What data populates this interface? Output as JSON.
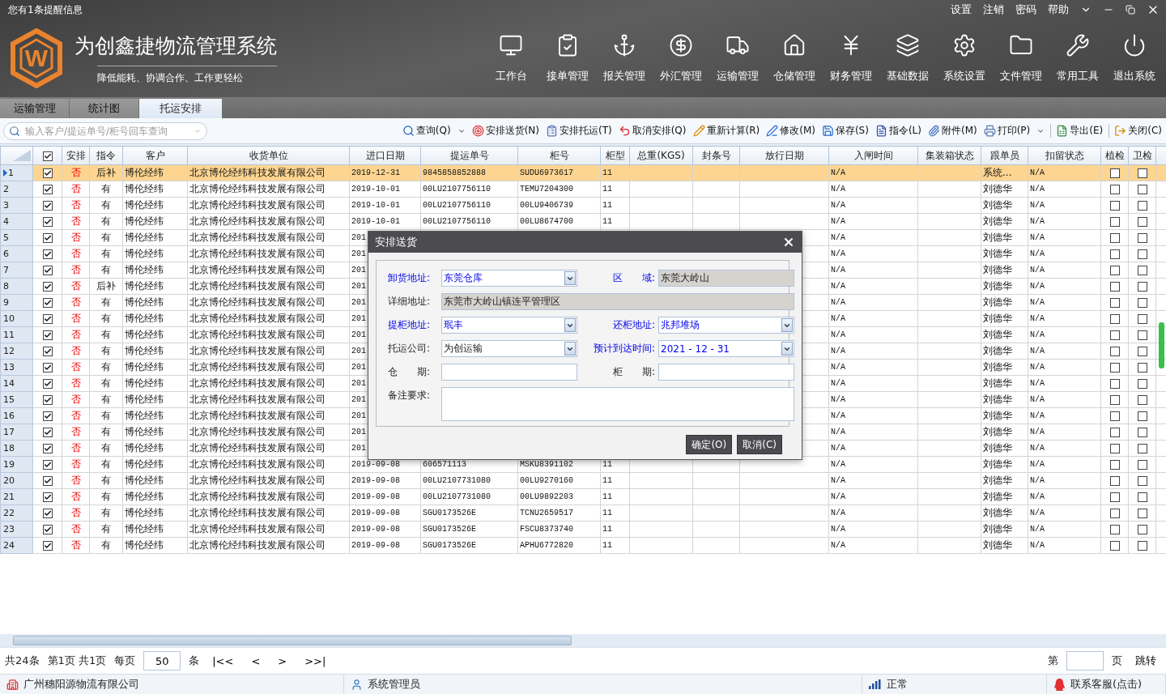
{
  "notice": "您有1条提醒信息",
  "top_links": [
    "设置",
    "注销",
    "密码",
    "帮助"
  ],
  "logo": {
    "letter": "W",
    "title": "为创鑫捷物流管理系统",
    "slogan": "降低能耗、协调合作、工作更轻松"
  },
  "nav": [
    {
      "label": "工作台"
    },
    {
      "label": "接单管理"
    },
    {
      "label": "报关管理"
    },
    {
      "label": "外汇管理"
    },
    {
      "label": "运输管理"
    },
    {
      "label": "仓储管理"
    },
    {
      "label": "财务管理"
    },
    {
      "label": "基础数据"
    },
    {
      "label": "系统设置"
    },
    {
      "label": "文件管理"
    },
    {
      "label": "常用工具"
    },
    {
      "label": "退出系统"
    }
  ],
  "tabs": [
    {
      "label": "运输管理",
      "selected": false
    },
    {
      "label": "统计图",
      "selected": false
    },
    {
      "label": "托运安排",
      "selected": true
    }
  ],
  "search": {
    "placeholder": "输入客户/提运单号/柜号回车查询"
  },
  "toolbar": [
    {
      "label": "查询(Q)",
      "dropdown": true,
      "separator_before": false
    },
    {
      "label": "安排送货(N)",
      "dropdown": false,
      "separator_before": false
    },
    {
      "label": "安排托运(T)",
      "dropdown": false,
      "separator_before": false
    },
    {
      "label": "取消安排(Q)",
      "dropdown": false,
      "separator_before": false
    },
    {
      "label": "重新计算(R)",
      "dropdown": false,
      "separator_before": false
    },
    {
      "label": "修改(M)",
      "dropdown": false,
      "separator_before": false
    },
    {
      "label": "保存(S)",
      "dropdown": false,
      "separator_before": false
    },
    {
      "label": "指令(L)",
      "dropdown": false,
      "separator_before": false
    },
    {
      "label": "附件(M)",
      "dropdown": false,
      "separator_before": false
    },
    {
      "label": "打印(P)",
      "dropdown": true,
      "separator_before": false
    },
    {
      "label": "导出(E)",
      "dropdown": false,
      "separator_before": true
    },
    {
      "label": "关闭(C)",
      "dropdown": false,
      "separator_before": true
    }
  ],
  "table": {
    "all_checked": true,
    "columns": [
      "安排",
      "指令",
      "客户",
      "收货单位",
      "进口日期",
      "提运单号",
      "柜号",
      "柜型",
      "总重(KGS)",
      "封条号",
      "放行日期",
      "入闸时间",
      "集装箱状态",
      "跟单员",
      "扣留状态",
      "植检",
      "卫检"
    ],
    "rows": [
      {
        "number": "1",
        "selected": true,
        "checked": true,
        "arrange": "否",
        "instruction": "后补",
        "customer": "博伦经纬",
        "consignee": "北京博伦经纬科技发展有限公司",
        "import_date": "2019-12-31",
        "bill_no": "9845858852888",
        "container_no": "SUDU6973617",
        "container_type": "11",
        "entry_time": "N/A",
        "follower": "系统...",
        "hold_status": "N/A",
        "plant_check": false,
        "health_check": false
      },
      {
        "number": "2",
        "selected": false,
        "checked": true,
        "arrange": "否",
        "instruction": "有",
        "customer": "博伦经纬",
        "consignee": "北京博伦经纬科技发展有限公司",
        "import_date": "2019-10-01",
        "bill_no": "00LU2107756110",
        "container_no": "TEMU7204300",
        "container_type": "11",
        "entry_time": "N/A",
        "follower": "刘德华",
        "hold_status": "N/A",
        "plant_check": false,
        "health_check": false
      },
      {
        "number": "3",
        "selected": false,
        "checked": true,
        "arrange": "否",
        "instruction": "有",
        "customer": "博伦经纬",
        "consignee": "北京博伦经纬科技发展有限公司",
        "import_date": "2019-10-01",
        "bill_no": "00LU2107756110",
        "container_no": "00LU9406739",
        "container_type": "11",
        "entry_time": "N/A",
        "follower": "刘德华",
        "hold_status": "N/A",
        "plant_check": false,
        "health_check": false
      },
      {
        "number": "4",
        "selected": false,
        "checked": true,
        "arrange": "否",
        "instruction": "有",
        "customer": "博伦经纬",
        "consignee": "北京博伦经纬科技发展有限公司",
        "import_date": "2019-10-01",
        "bill_no": "00LU2107756110",
        "container_no": "00LU8674700",
        "container_type": "11",
        "entry_time": "N/A",
        "follower": "刘德华",
        "hold_status": "N/A",
        "plant_check": false,
        "health_check": false
      },
      {
        "number": "5",
        "selected": false,
        "checked": true,
        "arrange": "否",
        "instruction": "有",
        "customer": "博伦经纬",
        "consignee": "北京博伦经纬科技发展有限公司",
        "import_date": "201",
        "entry_time": "N/A",
        "follower": "刘德华",
        "hold_status": "N/A",
        "plant_check": false,
        "health_check": false
      },
      {
        "number": "6",
        "selected": false,
        "checked": true,
        "arrange": "否",
        "instruction": "有",
        "customer": "博伦经纬",
        "consignee": "北京博伦经纬科技发展有限公司",
        "import_date": "201",
        "entry_time": "N/A",
        "follower": "刘德华",
        "hold_status": "N/A",
        "plant_check": false,
        "health_check": false
      },
      {
        "number": "7",
        "selected": false,
        "checked": true,
        "arrange": "否",
        "instruction": "有",
        "customer": "博伦经纬",
        "consignee": "北京博伦经纬科技发展有限公司",
        "import_date": "201",
        "entry_time": "N/A",
        "follower": "刘德华",
        "hold_status": "N/A",
        "plant_check": false,
        "health_check": false
      },
      {
        "number": "8",
        "selected": false,
        "checked": true,
        "arrange": "否",
        "instruction": "后补",
        "customer": "博伦经纬",
        "consignee": "北京博伦经纬科技发展有限公司",
        "import_date": "201",
        "entry_time": "N/A",
        "follower": "刘德华",
        "hold_status": "N/A",
        "plant_check": false,
        "health_check": false
      },
      {
        "number": "9",
        "selected": false,
        "checked": true,
        "arrange": "否",
        "instruction": "有",
        "customer": "博伦经纬",
        "consignee": "北京博伦经纬科技发展有限公司",
        "import_date": "201",
        "entry_time": "N/A",
        "follower": "刘德华",
        "hold_status": "N/A",
        "plant_check": false,
        "health_check": false
      },
      {
        "number": "10",
        "selected": false,
        "checked": true,
        "arrange": "否",
        "instruction": "有",
        "customer": "博伦经纬",
        "consignee": "北京博伦经纬科技发展有限公司",
        "import_date": "201",
        "entry_time": "N/A",
        "follower": "刘德华",
        "hold_status": "N/A",
        "plant_check": false,
        "health_check": false
      },
      {
        "number": "11",
        "selected": false,
        "checked": true,
        "arrange": "否",
        "instruction": "有",
        "customer": "博伦经纬",
        "consignee": "北京博伦经纬科技发展有限公司",
        "import_date": "201",
        "entry_time": "N/A",
        "follower": "刘德华",
        "hold_status": "N/A",
        "plant_check": false,
        "health_check": false
      },
      {
        "number": "12",
        "selected": false,
        "checked": true,
        "arrange": "否",
        "instruction": "有",
        "customer": "博伦经纬",
        "consignee": "北京博伦经纬科技发展有限公司",
        "import_date": "201",
        "entry_time": "N/A",
        "follower": "刘德华",
        "hold_status": "N/A",
        "plant_check": false,
        "health_check": false
      },
      {
        "number": "13",
        "selected": false,
        "checked": true,
        "arrange": "否",
        "instruction": "有",
        "customer": "博伦经纬",
        "consignee": "北京博伦经纬科技发展有限公司",
        "import_date": "201",
        "entry_time": "N/A",
        "follower": "刘德华",
        "hold_status": "N/A",
        "plant_check": false,
        "health_check": false
      },
      {
        "number": "14",
        "selected": false,
        "checked": true,
        "arrange": "否",
        "instruction": "有",
        "customer": "博伦经纬",
        "consignee": "北京博伦经纬科技发展有限公司",
        "import_date": "201",
        "entry_time": "N/A",
        "follower": "刘德华",
        "hold_status": "N/A",
        "plant_check": false,
        "health_check": false
      },
      {
        "number": "15",
        "selected": false,
        "checked": true,
        "arrange": "否",
        "instruction": "有",
        "customer": "博伦经纬",
        "consignee": "北京博伦经纬科技发展有限公司",
        "import_date": "201",
        "entry_time": "N/A",
        "follower": "刘德华",
        "hold_status": "N/A",
        "plant_check": false,
        "health_check": false
      },
      {
        "number": "16",
        "selected": false,
        "checked": true,
        "arrange": "否",
        "instruction": "有",
        "customer": "博伦经纬",
        "consignee": "北京博伦经纬科技发展有限公司",
        "import_date": "201",
        "entry_time": "N/A",
        "follower": "刘德华",
        "hold_status": "N/A",
        "plant_check": false,
        "health_check": false
      },
      {
        "number": "17",
        "selected": false,
        "checked": true,
        "arrange": "否",
        "instruction": "有",
        "customer": "博伦经纬",
        "consignee": "北京博伦经纬科技发展有限公司",
        "import_date": "201",
        "entry_time": "N/A",
        "follower": "刘德华",
        "hold_status": "N/A",
        "plant_check": false,
        "health_check": false
      },
      {
        "number": "18",
        "selected": false,
        "checked": true,
        "arrange": "否",
        "instruction": "有",
        "customer": "博伦经纬",
        "consignee": "北京博伦经纬科技发展有限公司",
        "import_date": "201",
        "entry_time": "N/A",
        "follower": "刘德华",
        "hold_status": "N/A",
        "plant_check": false,
        "health_check": false
      },
      {
        "number": "19",
        "selected": false,
        "checked": true,
        "arrange": "否",
        "instruction": "有",
        "customer": "博伦经纬",
        "consignee": "北京博伦经纬科技发展有限公司",
        "import_date": "2019-09-08",
        "bill_no": "606571113",
        "container_no": "MSKU8391102",
        "container_type": "11",
        "entry_time": "N/A",
        "follower": "刘德华",
        "hold_status": "N/A",
        "plant_check": false,
        "health_check": false
      },
      {
        "number": "20",
        "selected": false,
        "checked": true,
        "arrange": "否",
        "instruction": "有",
        "customer": "博伦经纬",
        "consignee": "北京博伦经纬科技发展有限公司",
        "import_date": "2019-09-08",
        "bill_no": "00LU2107731080",
        "container_no": "00LU9270160",
        "container_type": "11",
        "entry_time": "N/A",
        "follower": "刘德华",
        "hold_status": "N/A",
        "plant_check": false,
        "health_check": false
      },
      {
        "number": "21",
        "selected": false,
        "checked": true,
        "arrange": "否",
        "instruction": "有",
        "customer": "博伦经纬",
        "consignee": "北京博伦经纬科技发展有限公司",
        "import_date": "2019-09-08",
        "bill_no": "00LU2107731080",
        "container_no": "00LU9892203",
        "container_type": "11",
        "entry_time": "N/A",
        "follower": "刘德华",
        "hold_status": "N/A",
        "plant_check": false,
        "health_check": false
      },
      {
        "number": "22",
        "selected": false,
        "checked": true,
        "arrange": "否",
        "instruction": "有",
        "customer": "博伦经纬",
        "consignee": "北京博伦经纬科技发展有限公司",
        "import_date": "2019-09-08",
        "bill_no": "SGU0173526E",
        "container_no": "TCNU2659517",
        "container_type": "11",
        "entry_time": "N/A",
        "follower": "刘德华",
        "hold_status": "N/A",
        "plant_check": false,
        "health_check": false
      },
      {
        "number": "23",
        "selected": false,
        "checked": true,
        "arrange": "否",
        "instruction": "有",
        "customer": "博伦经纬",
        "consignee": "北京博伦经纬科技发展有限公司",
        "import_date": "2019-09-08",
        "bill_no": "SGU0173526E",
        "container_no": "FSCU8373740",
        "container_type": "11",
        "entry_time": "N/A",
        "follower": "刘德华",
        "hold_status": "N/A",
        "plant_check": false,
        "health_check": false
      },
      {
        "number": "24",
        "selected": false,
        "checked": true,
        "arrange": "否",
        "instruction": "有",
        "customer": "博伦经纬",
        "consignee": "北京博伦经纬科技发展有限公司",
        "import_date": "2019-09-08",
        "bill_no": "SGU0173526E",
        "container_no": "APHU6772820",
        "container_type": "11",
        "entry_time": "N/A",
        "follower": "刘德华",
        "hold_status": "N/A",
        "plant_check": false,
        "health_check": false
      }
    ]
  },
  "pager": {
    "total": "共24条",
    "page_info": "第1页 共1页",
    "per_page_label": "每页",
    "per_page": "50",
    "unit": "条",
    "first": "|<<",
    "prev": "<",
    "next": ">",
    "last": ">>|",
    "goto_label": "第",
    "page_unit": "页",
    "jump": "跳转"
  },
  "status_bar": {
    "company": "广州穗阳源物流有限公司",
    "user": "系统管理员",
    "network": "正常",
    "support": "联系客服(点击)"
  },
  "dialog": {
    "title": "安排送货",
    "fields": [
      {
        "kind": "select",
        "label": "卸货地址:",
        "value": "东莞仓库",
        "required": true,
        "span": false
      },
      {
        "kind": "readonly",
        "label": "区　　域:",
        "value": "东莞大岭山",
        "required": true,
        "span": false
      },
      {
        "kind": "readonly",
        "label": "详细地址:",
        "value": "东莞市大岭山镇连平管理区",
        "required": false,
        "span": true
      },
      {
        "kind": "select",
        "label": "提柜地址:",
        "value": "珉丰",
        "required": true,
        "span": false
      },
      {
        "kind": "select",
        "label": "还柜地址:",
        "value": "兆邦堆场",
        "required": true,
        "span": false
      },
      {
        "kind": "select",
        "label": "托运公司:",
        "value": "为创运输",
        "required": false,
        "span": false
      },
      {
        "kind": "select",
        "label": "预计到达时间:",
        "value": "2021 - 12 - 31",
        "required": true,
        "span": false
      },
      {
        "kind": "input",
        "label": "仓　　期:",
        "required": false,
        "span": false
      },
      {
        "kind": "input",
        "label": "柜　　期:",
        "required": false,
        "span": false
      },
      {
        "kind": "textarea",
        "label": "备注要求:",
        "required": false,
        "span": true
      }
    ],
    "buttons": [
      "确定(O)",
      "取消(C)"
    ]
  }
}
